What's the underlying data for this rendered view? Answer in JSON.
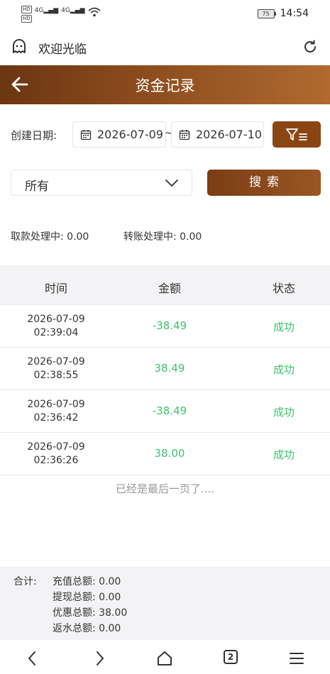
{
  "status_bar": {
    "hd1": "HD",
    "hd2": "HD",
    "signal1": "4G",
    "signal2": "4G",
    "battery": "75",
    "time": "14:54"
  },
  "browser": {
    "title": "欢迎光临"
  },
  "header": {
    "title": "资金记录"
  },
  "filters": {
    "date_label": "创建日期:",
    "start_date": "2026-07-09",
    "separator": "~",
    "end_date": "2026-07-10",
    "type_selected": "所有",
    "search_label": "搜索"
  },
  "pending": {
    "withdraw": "取款处理中: 0.00",
    "transfer": "转账处理中: 0.00"
  },
  "table": {
    "columns": [
      "时间",
      "金额",
      "状态"
    ],
    "rows": [
      {
        "date": "2026-07-09",
        "time": "02:39:04",
        "amount": "-38.49",
        "status": "成功"
      },
      {
        "date": "2026-07-09",
        "time": "02:38:55",
        "amount": "38.49",
        "status": "成功"
      },
      {
        "date": "2026-07-09",
        "time": "02:36:42",
        "amount": "-38.49",
        "status": "成功"
      },
      {
        "date": "2026-07-09",
        "time": "02:36:26",
        "amount": "38.00",
        "status": "成功"
      }
    ],
    "end_note": "已经是最后一页了...."
  },
  "totals": {
    "label": "合计:",
    "recharge": "充值总额: 0.00",
    "withdraw": "提现总额: 0.00",
    "bonus": "优惠总额: 38.00",
    "rebate": "返水总额: 0.00"
  },
  "nav": {
    "tab_count": "2"
  },
  "colors": {
    "brand": "#8b4513",
    "success": "#3cc36b"
  }
}
